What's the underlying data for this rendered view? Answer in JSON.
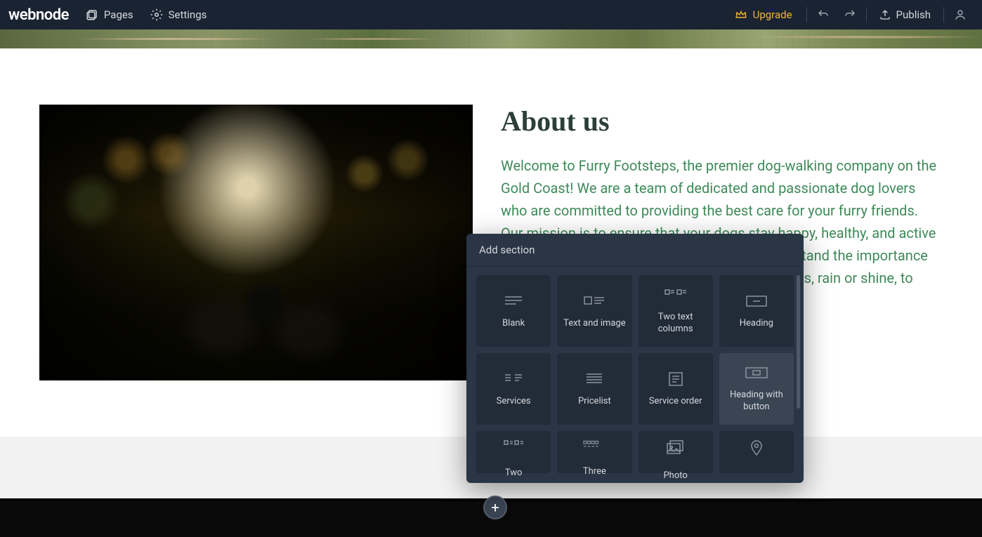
{
  "topbar": {
    "logo": "webnode",
    "pages": "Pages",
    "settings": "Settings",
    "upgrade": "Upgrade",
    "publish": "Publish"
  },
  "about": {
    "heading": "About us",
    "body": "Welcome to Furry Footsteps, the premier dog-walking company on the Gold Coast! We are a team of dedicated and passionate dog lovers who are committed to providing the best care for your furry friends. Our mission is to ensure that your dogs stay happy, healthy, and active while you're away. At Furry Footsteps, we understand the importance of regular exercise, that's why we offer daily walks, rain or shine, to keep your dogs active and engaged."
  },
  "popup": {
    "title": "Add section",
    "options": [
      {
        "id": "blank",
        "label": "Blank"
      },
      {
        "id": "text-image",
        "label": "Text and image"
      },
      {
        "id": "two-cols",
        "label": "Two text columns"
      },
      {
        "id": "heading",
        "label": "Heading"
      },
      {
        "id": "services",
        "label": "Services"
      },
      {
        "id": "pricelist",
        "label": "Pricelist"
      },
      {
        "id": "service-order",
        "label": "Service order"
      },
      {
        "id": "heading-button",
        "label": "Heading with button"
      },
      {
        "id": "two",
        "label": "Two"
      },
      {
        "id": "three",
        "label": "Three"
      },
      {
        "id": "photo",
        "label": "Photo"
      },
      {
        "id": "map",
        "label": ""
      }
    ]
  },
  "add_button": "+"
}
